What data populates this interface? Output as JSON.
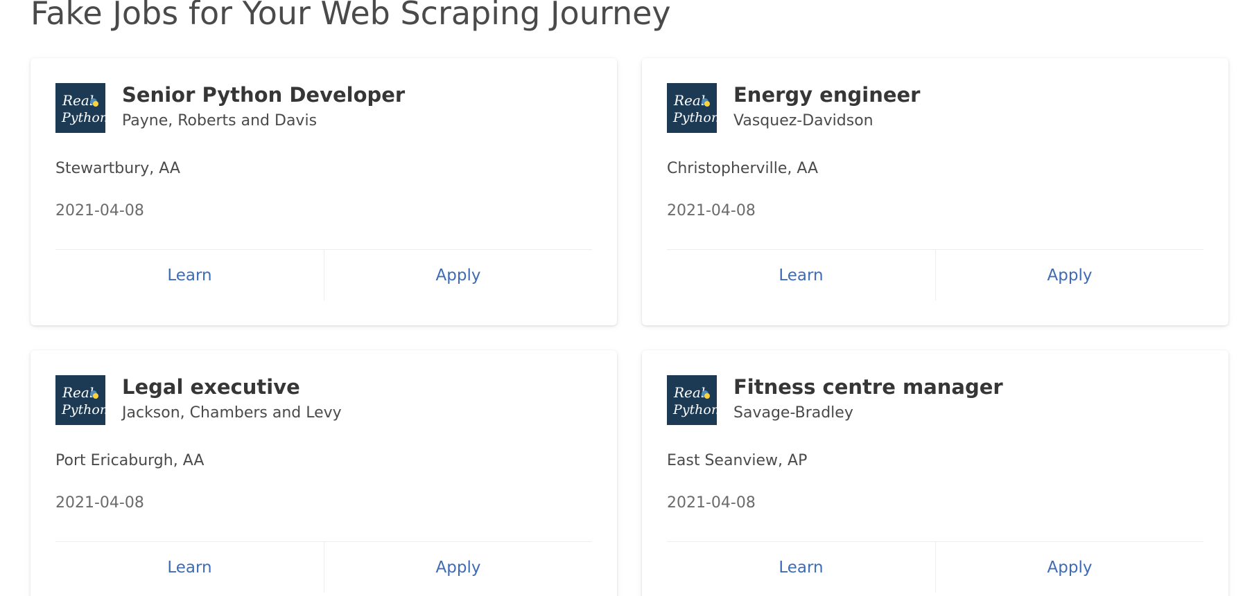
{
  "page": {
    "title": "Fake Jobs for Your Web Scraping Journey"
  },
  "theme": {
    "link_color": "#3e6bb5",
    "logo_background": "#1d3a55",
    "logo_accent_blue": "#4b8bbe",
    "logo_accent_yellow": "#ffd43b"
  },
  "jobs": [
    {
      "title": "Senior Python Developer",
      "company": "Payne, Roberts and Davis",
      "location": "Stewartbury, AA",
      "date": "2021-04-08",
      "logo_line1": "Real",
      "logo_line2": "Python",
      "learn_label": "Learn",
      "apply_label": "Apply"
    },
    {
      "title": "Energy engineer",
      "company": "Vasquez-Davidson",
      "location": "Christopherville, AA",
      "date": "2021-04-08",
      "logo_line1": "Real",
      "logo_line2": "Python",
      "learn_label": "Learn",
      "apply_label": "Apply"
    },
    {
      "title": "Legal executive",
      "company": "Jackson, Chambers and Levy",
      "location": "Port Ericaburgh, AA",
      "date": "2021-04-08",
      "logo_line1": "Real",
      "logo_line2": "Python",
      "learn_label": "Learn",
      "apply_label": "Apply"
    },
    {
      "title": "Fitness centre manager",
      "company": "Savage-Bradley",
      "location": "East Seanview, AP",
      "date": "2021-04-08",
      "logo_line1": "Real",
      "logo_line2": "Python",
      "learn_label": "Learn",
      "apply_label": "Apply"
    }
  ]
}
